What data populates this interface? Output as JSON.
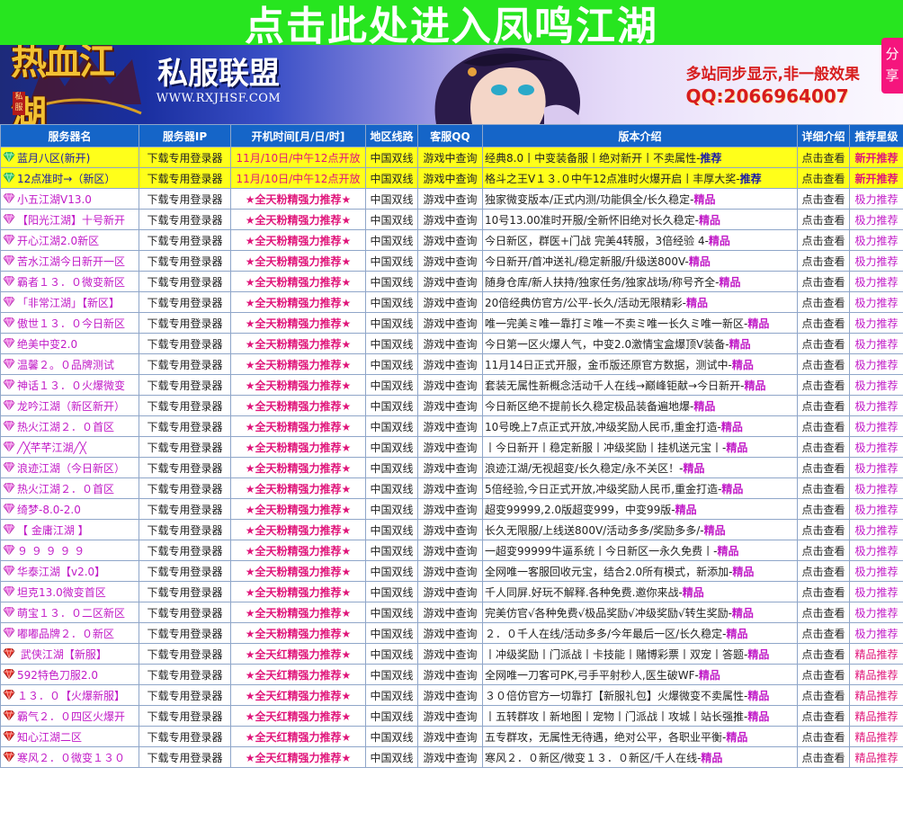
{
  "banner": {
    "text": "点击此处进入凤鸣江湖"
  },
  "header": {
    "logo_text": "热血江湖",
    "logo_tag": "私服",
    "alliance_title": "私服联盟",
    "alliance_url": "WWW.RXJHSF.COM",
    "promo_line1": "多站同步显示,非一般效果",
    "promo_line2": "QQ:2066964007"
  },
  "share": {
    "label": "分享"
  },
  "table": {
    "headers": [
      "服务器名",
      "服务器IP",
      "开机时间[月/日/时]",
      "地区线路",
      "客服QQ",
      "版本介绍",
      "详细介绍",
      "推荐星级"
    ],
    "rows": [
      {
        "name": "蓝月八区(新开)",
        "ip": "下载专用登录器",
        "time": "11月/10日/中午12点开放",
        "line": "中国双线",
        "qq": "游戏中查询",
        "intro": "经典8.0丨中变装备服丨绝对新开丨不卖属性-",
        "tag": "推荐",
        "detail": "点击查看",
        "rec": "新开推荐",
        "style": "hl",
        "gem": "green"
      },
      {
        "name": "12点准时→（新区）",
        "ip": "下载专用登录器",
        "time": "11月/10日/中午12点开放",
        "line": "中国双线",
        "qq": "游戏中查询",
        "intro": "格斗之王V１３.０中午12点准时火爆开启丨丰厚大奖-",
        "tag": "推荐",
        "detail": "点击查看",
        "rec": "新开推荐",
        "style": "hl",
        "gem": "green"
      },
      {
        "name": "小五江湖V13.0",
        "ip": "下载专用登录器",
        "time": "★全天粉精强力推荐★",
        "line": "中国双线",
        "qq": "游戏中查询",
        "intro": "独家微变版本/正式内测/功能俱全/长久稳定-",
        "tag": "精品",
        "detail": "点击查看",
        "rec": "极力推荐",
        "style": "normal",
        "gem": "pink"
      },
      {
        "name": "【阳光江湖】十号新开",
        "ip": "下载专用登录器",
        "time": "★全天粉精强力推荐★",
        "line": "中国双线",
        "qq": "游戏中查询",
        "intro": "10号13.00准时开服/全新怀旧绝对长久稳定-",
        "tag": "精品",
        "detail": "点击查看",
        "rec": "极力推荐",
        "style": "normal",
        "gem": "pink"
      },
      {
        "name": "开心江湖2.0新区",
        "ip": "下载专用登录器",
        "time": "★全天粉精强力推荐★",
        "line": "中国双线",
        "qq": "游戏中查询",
        "intro": "今日新区，群医+门战 完美4转服，3倍经验 4-",
        "tag": "精品",
        "detail": "点击查看",
        "rec": "极力推荐",
        "style": "normal",
        "gem": "pink"
      },
      {
        "name": "苦水江湖今日新开一区",
        "ip": "下载专用登录器",
        "time": "★全天粉精强力推荐★",
        "line": "中国双线",
        "qq": "游戏中查询",
        "intro": "今日新开/首冲送礼/稳定新服/升级送800V-",
        "tag": "精品",
        "detail": "点击查看",
        "rec": "极力推荐",
        "style": "normal",
        "gem": "pink"
      },
      {
        "name": "霸者１３．０微变新区",
        "ip": "下载专用登录器",
        "time": "★全天粉精强力推荐★",
        "line": "中国双线",
        "qq": "游戏中查询",
        "intro": "随身仓库/新人扶持/独家任务/独家战场/称号齐全-",
        "tag": "精品",
        "detail": "点击查看",
        "rec": "极力推荐",
        "style": "normal",
        "gem": "pink"
      },
      {
        "name": "「非常江湖」【新区】",
        "ip": "下载专用登录器",
        "time": "★全天粉精强力推荐★",
        "line": "中国双线",
        "qq": "游戏中查询",
        "intro": "20倍经典仿官方/公平-长久/活动无限精彩-",
        "tag": "精品",
        "detail": "点击查看",
        "rec": "极力推荐",
        "style": "normal",
        "gem": "pink"
      },
      {
        "name": "傲世１３．０今日新区",
        "ip": "下载专用登录器",
        "time": "★全天粉精强力推荐★",
        "line": "中国双线",
        "qq": "游戏中查询",
        "intro": "唯一完美ミ唯一靠打ミ唯一不卖ミ唯一长久ミ唯一新区-",
        "tag": "精品",
        "detail": "点击查看",
        "rec": "极力推荐",
        "style": "normal",
        "gem": "pink"
      },
      {
        "name": "绝美中变2.0",
        "ip": "下载专用登录器",
        "time": "★全天粉精强力推荐★",
        "line": "中国双线",
        "qq": "游戏中查询",
        "intro": "今日第一区火爆人气，中变2.0激情宝盒爆顶V装备-",
        "tag": "精品",
        "detail": "点击查看",
        "rec": "极力推荐",
        "style": "normal",
        "gem": "pink"
      },
      {
        "name": "温馨２。０品牌测试",
        "ip": "下载专用登录器",
        "time": "★全天粉精强力推荐★",
        "line": "中国双线",
        "qq": "游戏中查询",
        "intro": "11月14日正式开服，金币版还原官方数据，测试中-",
        "tag": "精品",
        "detail": "点击查看",
        "rec": "极力推荐",
        "style": "normal",
        "gem": "pink"
      },
      {
        "name": "神话１３．０火爆微变",
        "ip": "下载专用登录器",
        "time": "★全天粉精强力推荐★",
        "line": "中国双线",
        "qq": "游戏中查询",
        "intro": "套装无属性新概念活动千人在线→巅峰钜献→今日新开-",
        "tag": "精品",
        "detail": "点击查看",
        "rec": "极力推荐",
        "style": "normal",
        "gem": "pink"
      },
      {
        "name": "龙吟江湖（新区新开）",
        "ip": "下载专用登录器",
        "time": "★全天粉精强力推荐★",
        "line": "中国双线",
        "qq": "游戏中查询",
        "intro": "今日新区绝不提前长久稳定极品装备遍地爆-",
        "tag": "精品",
        "detail": "点击查看",
        "rec": "极力推荐",
        "style": "normal",
        "gem": "pink"
      },
      {
        "name": "热火江湖２．０首区",
        "ip": "下载专用登录器",
        "time": "★全天粉精强力推荐★",
        "line": "中国双线",
        "qq": "游戏中查询",
        "intro": "10号晚上7点正式开放,冲级奖励人民币,重金打造-",
        "tag": "精品",
        "detail": "点击查看",
        "rec": "极力推荐",
        "style": "normal",
        "gem": "pink"
      },
      {
        "name": "╱╳芊芊江湖╱╳",
        "ip": "下载专用登录器",
        "time": "★全天粉精强力推荐★",
        "line": "中国双线",
        "qq": "游戏中查询",
        "intro": "丨今日新开丨稳定新服丨冲级奖励丨挂机送元宝丨-",
        "tag": "精品",
        "detail": "点击查看",
        "rec": "极力推荐",
        "style": "normal",
        "gem": "pink"
      },
      {
        "name": "浪迹江湖（今日新区）",
        "ip": "下载专用登录器",
        "time": "★全天粉精强力推荐★",
        "line": "中国双线",
        "qq": "游戏中查询",
        "intro": "浪迹江湖/无视超变/长久稳定/永不关区！-",
        "tag": "精品",
        "detail": "点击查看",
        "rec": "极力推荐",
        "style": "normal",
        "gem": "pink"
      },
      {
        "name": "热火江湖２．０首区",
        "ip": "下载专用登录器",
        "time": "★全天粉精强力推荐★",
        "line": "中国双线",
        "qq": "游戏中查询",
        "intro": "5倍经验,今日正式开放,冲级奖励人民币,重金打造-",
        "tag": "精品",
        "detail": "点击查看",
        "rec": "极力推荐",
        "style": "normal",
        "gem": "pink"
      },
      {
        "name": "绮梦-8.0-2.0",
        "ip": "下载专用登录器",
        "time": "★全天粉精强力推荐★",
        "line": "中国双线",
        "qq": "游戏中查询",
        "intro": "超变99999,2.0版超变999，中变99版-",
        "tag": "精品",
        "detail": "点击查看",
        "rec": "极力推荐",
        "style": "normal",
        "gem": "pink"
      },
      {
        "name": "【 金庸江湖 】",
        "ip": "下载专用登录器",
        "time": "★全天粉精强力推荐★",
        "line": "中国双线",
        "qq": "游戏中查询",
        "intro": "长久无限服/上线送800V/活动多多/奖励多多/-",
        "tag": "精品",
        "detail": "点击查看",
        "rec": "极力推荐",
        "style": "normal",
        "gem": "pink"
      },
      {
        "name": "９ ９ ９ ９ ９",
        "ip": "下载专用登录器",
        "time": "★全天粉精强力推荐★",
        "line": "中国双线",
        "qq": "游戏中查询",
        "intro": "一超变99999牛逼系统丨今日新区一永久免费丨-",
        "tag": "精品",
        "detail": "点击查看",
        "rec": "极力推荐",
        "style": "normal",
        "gem": "pink"
      },
      {
        "name": "华泰江湖【v2.0】",
        "ip": "下载专用登录器",
        "time": "★全天粉精强力推荐★",
        "line": "中国双线",
        "qq": "游戏中查询",
        "intro": "全网唯一客服回收元宝，结合2.0所有模式，新添加-",
        "tag": "精品",
        "detail": "点击查看",
        "rec": "极力推荐",
        "style": "normal",
        "gem": "pink"
      },
      {
        "name": "坦克13.0微变首区",
        "ip": "下载专用登录器",
        "time": "★全天粉精强力推荐★",
        "line": "中国双线",
        "qq": "游戏中查询",
        "intro": "千人同屏.好玩不解释.各种免费.邀你来战-",
        "tag": "精品",
        "detail": "点击查看",
        "rec": "极力推荐",
        "style": "normal",
        "gem": "pink"
      },
      {
        "name": "萌宝１３．０二区新区",
        "ip": "下载专用登录器",
        "time": "★全天粉精强力推荐★",
        "line": "中国双线",
        "qq": "游戏中查询",
        "intro": "完美仿官√各种免费√极品奖励√冲级奖励√转生奖励-",
        "tag": "精品",
        "detail": "点击查看",
        "rec": "极力推荐",
        "style": "normal",
        "gem": "pink"
      },
      {
        "name": "嘟嘟品牌２．０新区",
        "ip": "下载专用登录器",
        "time": "★全天粉精强力推荐★",
        "line": "中国双线",
        "qq": "游戏中查询",
        "intro": "２．０千人在线/活动多多/今年最后一区/长久稳定-",
        "tag": "精品",
        "detail": "点击查看",
        "rec": "极力推荐",
        "style": "normal",
        "gem": "pink"
      },
      {
        "name": "   武侠江湖【新服】",
        "ip": "下载专用登录器",
        "time": "★全天红精强力推荐★",
        "line": "中国双线",
        "qq": "游戏中查询",
        "intro": "丨冲级奖励丨门派战丨卡技能丨赌博彩票丨双宠丨答题-",
        "tag": "精品",
        "detail": "点击查看",
        "rec": "精品推荐",
        "style": "red",
        "gem": "red"
      },
      {
        "name": "592特色刀服2.0",
        "ip": "下载专用登录器",
        "time": "★全天红精强力推荐★",
        "line": "中国双线",
        "qq": "游戏中查询",
        "intro": "全网唯一刀客可PK,弓手平射秒人,医生破WF-",
        "tag": "精品",
        "detail": "点击查看",
        "rec": "精品推荐",
        "style": "red",
        "gem": "red"
      },
      {
        "name": "１３．０【火爆新服】",
        "ip": "下载专用登录器",
        "time": "★全天红精强力推荐★",
        "line": "中国双线",
        "qq": "游戏中查询",
        "intro": "３０倍仿官方一切靠打【新服礼包】火爆微变不卖属性-",
        "tag": "精品",
        "detail": "点击查看",
        "rec": "精品推荐",
        "style": "red",
        "gem": "red"
      },
      {
        "name": "霸气２．０四区火爆开",
        "ip": "下载专用登录器",
        "time": "★全天红精强力推荐★",
        "line": "中国双线",
        "qq": "游戏中查询",
        "intro": "丨五转群攻丨新地图丨宠物丨门派战丨攻城丨站长强推-",
        "tag": "精品",
        "detail": "点击查看",
        "rec": "精品推荐",
        "style": "red",
        "gem": "red"
      },
      {
        "name": "知心江湖二区",
        "ip": "下载专用登录器",
        "time": "★全天红精强力推荐★",
        "line": "中国双线",
        "qq": "游戏中查询",
        "intro": "五专群攻，无属性无待遇，绝对公平，各职业平衡-",
        "tag": "精品",
        "detail": "点击查看",
        "rec": "精品推荐",
        "style": "red",
        "gem": "red"
      },
      {
        "name": "寒风２．０微变１３０",
        "ip": "下载专用登录器",
        "time": "★全天红精强力推荐★",
        "line": "中国双线",
        "qq": "游戏中查询",
        "intro": "寒风２．０新区/微变１３．０新区/千人在线-",
        "tag": "精品",
        "detail": "点击查看",
        "rec": "精品推荐",
        "style": "red",
        "gem": "red"
      }
    ]
  },
  "colors": {
    "banner_bg": "#27e51f",
    "header_row_bg": "#1565c8",
    "highlight_row_bg": "#ffff1a",
    "name_pink": "#c11ac7",
    "time_red": "#e0157a",
    "share_bg": "#f5157d"
  }
}
